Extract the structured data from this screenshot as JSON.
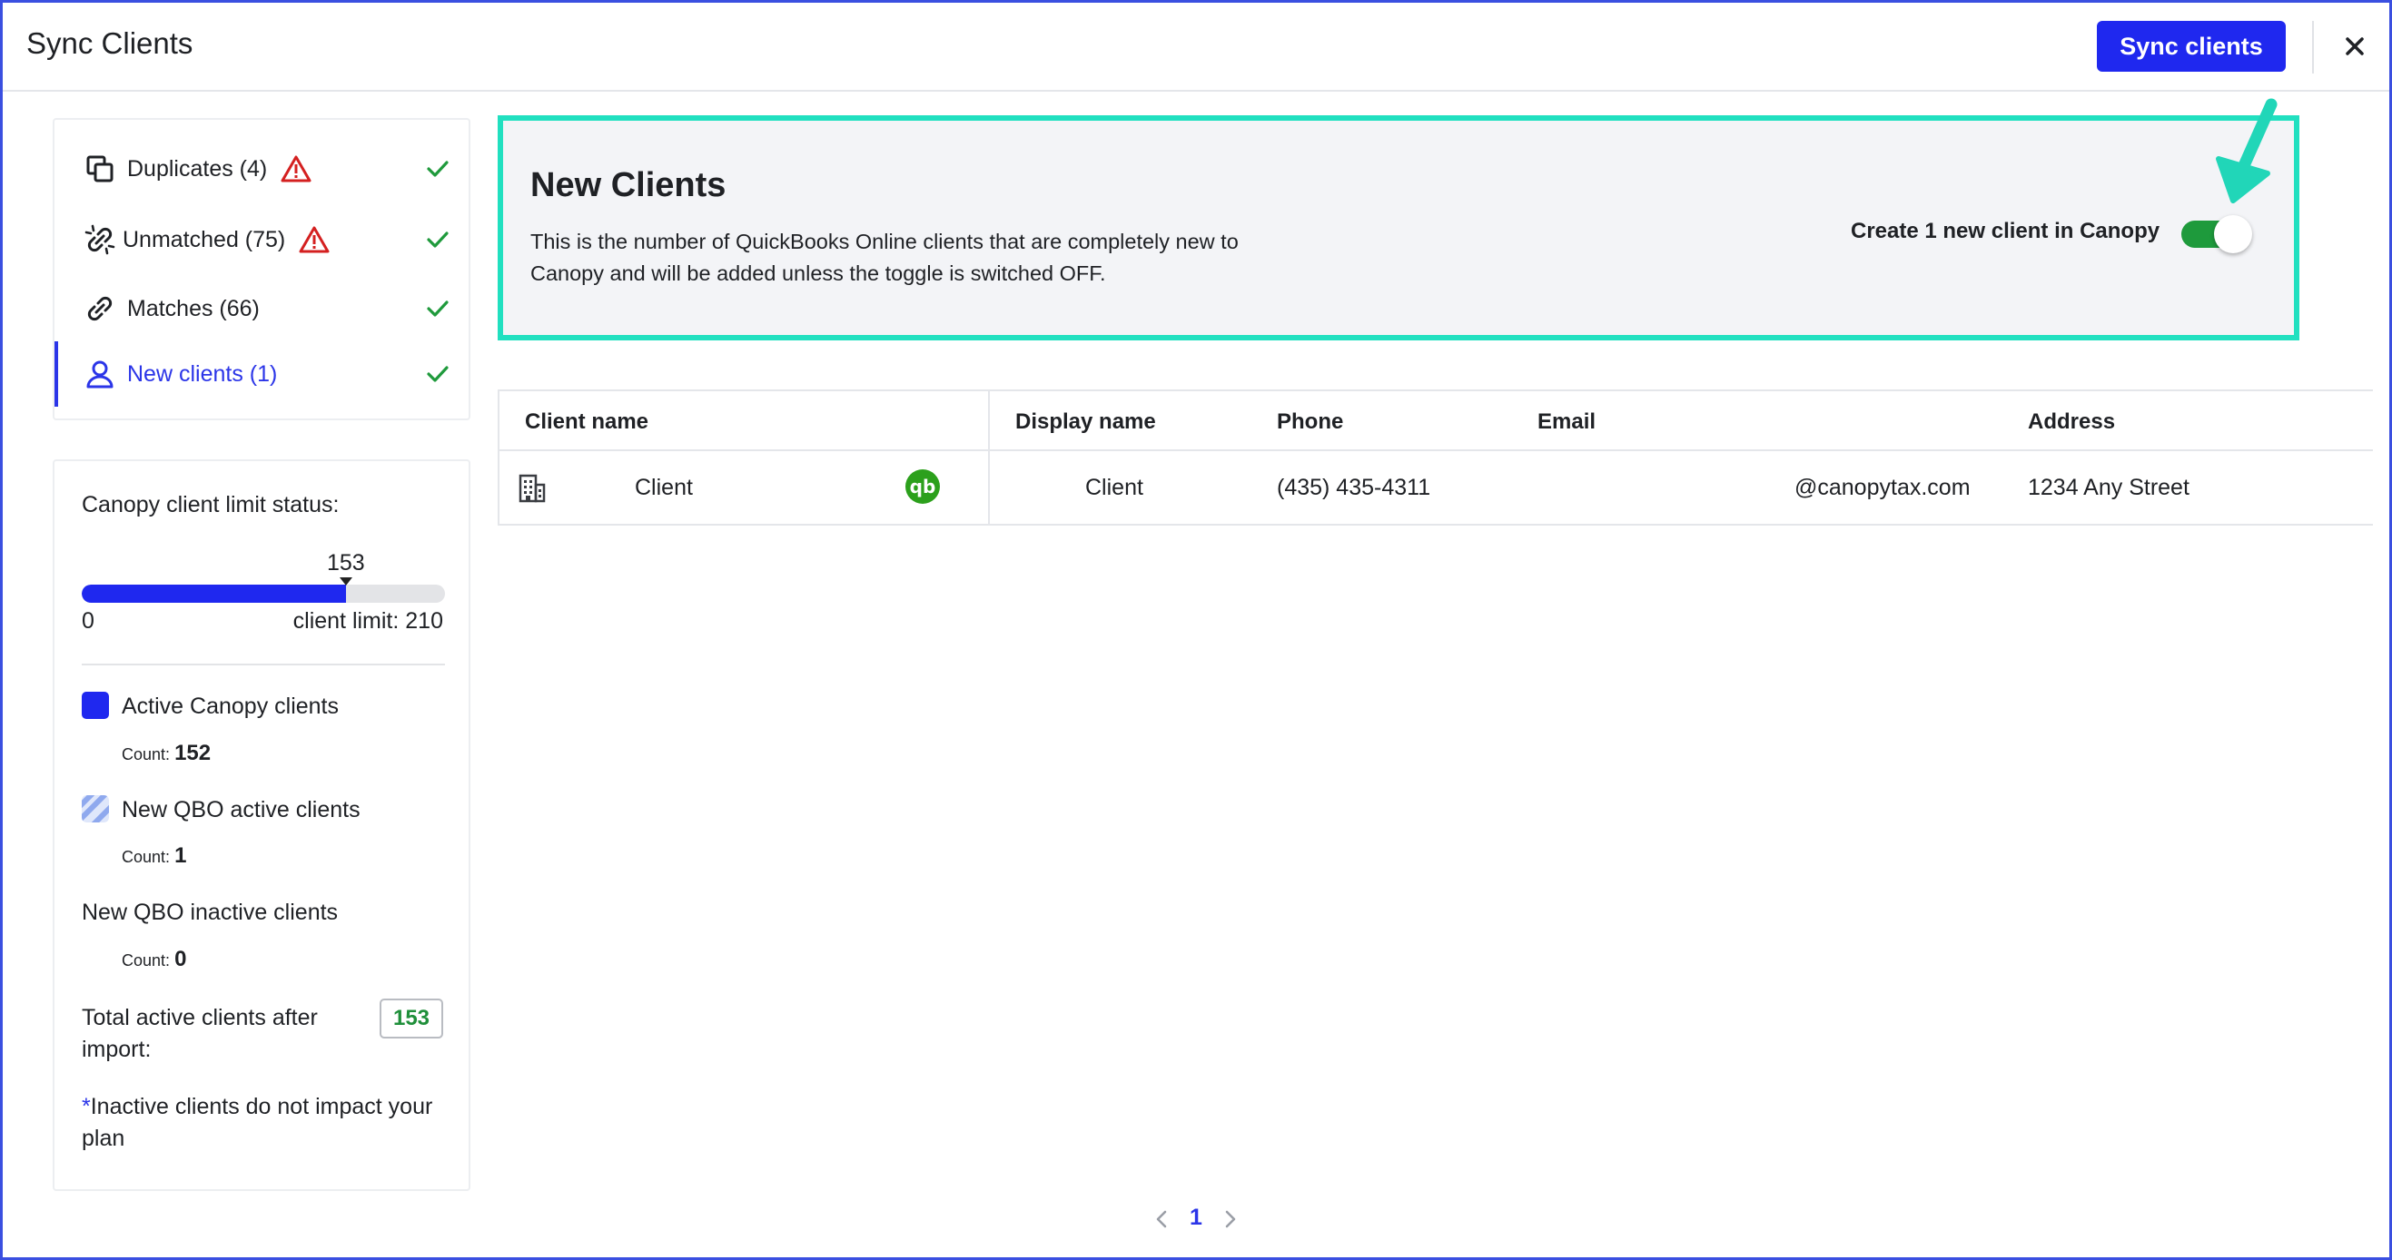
{
  "header": {
    "title": "Sync Clients",
    "sync_button": "Sync clients",
    "close_icon": "close-icon"
  },
  "nav": {
    "items": [
      {
        "label": "Duplicates (4)",
        "icon": "duplicate-icon",
        "warning": true,
        "checked": true
      },
      {
        "label": "Unmatched (75)",
        "icon": "broken-link-icon",
        "warning": true,
        "checked": true
      },
      {
        "label": "Matches (66)",
        "icon": "link-icon",
        "warning": false,
        "checked": true
      },
      {
        "label": "New clients (1)",
        "icon": "user-icon",
        "warning": false,
        "checked": true,
        "active": true
      }
    ]
  },
  "limit": {
    "title": "Canopy client limit status:",
    "current": "153",
    "min": "0",
    "limit_label": "client limit: 210",
    "fill_fraction": 0.728,
    "legend": [
      {
        "label": "Active Canopy clients",
        "count_label": "Count:",
        "count": "152",
        "color": "#1f28ef"
      },
      {
        "label": "New QBO active clients",
        "count_label": "Count:",
        "count": "1",
        "color": "#a9bdf5"
      },
      {
        "label": "New QBO inactive clients",
        "count_label": "Count:",
        "count": "0"
      }
    ],
    "total_label": "Total active clients after import:",
    "total_value": "153",
    "footnote_star": "*",
    "footnote": "Inactive clients do not impact your plan"
  },
  "banner": {
    "title": "New Clients",
    "description": "This is the number of QuickBooks Online clients that are completely new to Canopy and will be added unless the toggle is switched OFF.",
    "toggle_label": "Create 1 new client in Canopy",
    "toggle_on": true,
    "accent": "#21e0c0"
  },
  "table": {
    "columns": [
      "Client name",
      "Display name",
      "Phone",
      "Email",
      "Address"
    ],
    "rows": [
      {
        "client_name": "Client",
        "display_name": "Client",
        "phone": "(435) 435-4311",
        "email": "@canopytax.com",
        "address": "1234 Any Street"
      }
    ],
    "qb_badge": "qb"
  },
  "pagination": {
    "current_page": "1"
  }
}
